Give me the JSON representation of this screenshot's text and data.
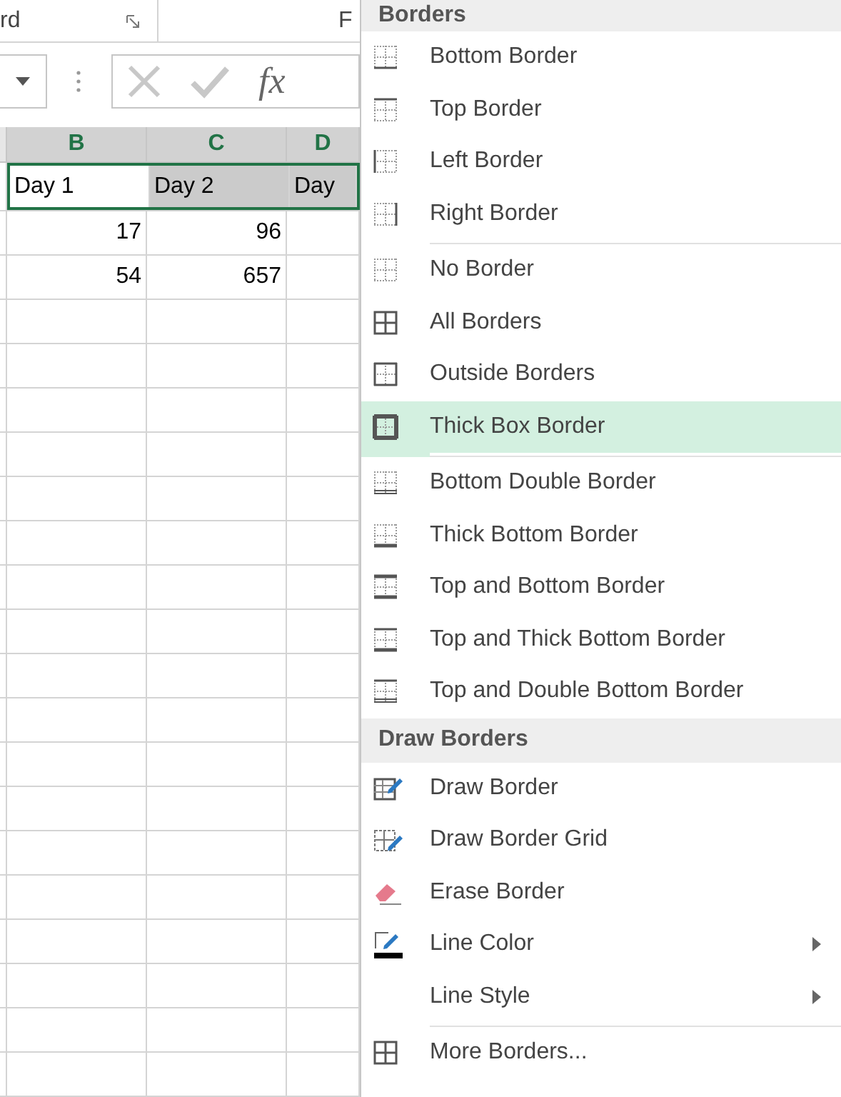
{
  "ribbon": {
    "group_label": "rd",
    "next_group_label": "F"
  },
  "formula_bar": {
    "function_label": "fx"
  },
  "sheet": {
    "columns": [
      {
        "label": "B",
        "selected": true
      },
      {
        "label": "C",
        "selected": true
      },
      {
        "label": "D",
        "selected": true
      }
    ],
    "rows": [
      {
        "selected": true,
        "cells": [
          {
            "text": "Day 1",
            "kind": "text",
            "shaded": false
          },
          {
            "text": "Day 2",
            "kind": "text",
            "shaded": true
          },
          {
            "text": "Day",
            "kind": "text",
            "shaded": true
          }
        ]
      },
      {
        "selected": false,
        "cells": [
          {
            "text": "17",
            "kind": "number",
            "shaded": false
          },
          {
            "text": "96",
            "kind": "number",
            "shaded": false
          }
        ]
      },
      {
        "selected": false,
        "cells": [
          {
            "text": "54",
            "kind": "number",
            "shaded": false
          },
          {
            "text": "657",
            "kind": "number",
            "shaded": false
          }
        ]
      }
    ]
  },
  "menu": {
    "sections": [
      {
        "title": "Borders",
        "items": [
          {
            "label": "Bottom Border",
            "selected": false,
            "submenu": false,
            "separator_after": false
          },
          {
            "label": "Top Border",
            "selected": false,
            "submenu": false,
            "separator_after": false
          },
          {
            "label": "Left Border",
            "selected": false,
            "submenu": false,
            "separator_after": false
          },
          {
            "label": "Right Border",
            "selected": false,
            "submenu": false,
            "separator_after": true
          },
          {
            "label": "No Border",
            "selected": false,
            "submenu": false,
            "separator_after": false
          },
          {
            "label": "All Borders",
            "selected": false,
            "submenu": false,
            "separator_after": false
          },
          {
            "label": "Outside Borders",
            "selected": false,
            "submenu": false,
            "separator_after": false
          },
          {
            "label": "Thick Box Border",
            "selected": true,
            "submenu": false,
            "separator_after": true
          },
          {
            "label": "Bottom Double Border",
            "selected": false,
            "submenu": false,
            "separator_after": false
          },
          {
            "label": "Thick Bottom Border",
            "selected": false,
            "submenu": false,
            "separator_after": false
          },
          {
            "label": "Top and Bottom Border",
            "selected": false,
            "submenu": false,
            "separator_after": false
          },
          {
            "label": "Top and Thick Bottom Border",
            "selected": false,
            "submenu": false,
            "separator_after": false
          },
          {
            "label": "Top and Double Bottom Border",
            "selected": false,
            "submenu": false,
            "separator_after": false
          }
        ]
      },
      {
        "title": "Draw Borders",
        "items": [
          {
            "label": "Draw Border",
            "selected": false,
            "submenu": false,
            "separator_after": false
          },
          {
            "label": "Draw Border Grid",
            "selected": false,
            "submenu": false,
            "separator_after": false
          },
          {
            "label": "Erase Border",
            "selected": false,
            "submenu": false,
            "separator_after": false
          },
          {
            "label": "Line Color",
            "selected": false,
            "submenu": true,
            "separator_after": false
          },
          {
            "label": "Line Style",
            "selected": false,
            "submenu": true,
            "separator_after": true
          },
          {
            "label": "More Borders...",
            "selected": false,
            "submenu": false,
            "separator_after": false
          }
        ]
      }
    ]
  }
}
